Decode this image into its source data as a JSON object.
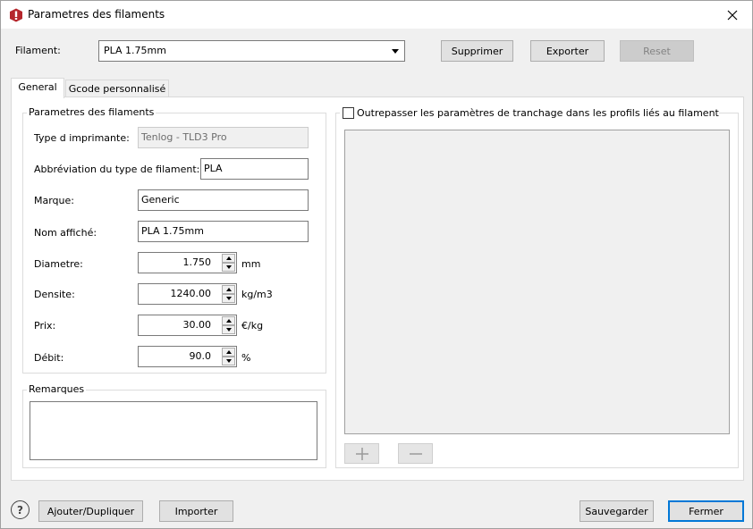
{
  "window": {
    "title": "Parametres des filaments"
  },
  "filament_row": {
    "label": "Filament:",
    "selected": "PLA 1.75mm"
  },
  "top_buttons": {
    "delete": "Supprimer",
    "export": "Exporter",
    "reset": "Reset"
  },
  "tabs": [
    {
      "label": "General"
    },
    {
      "label": "Gcode personnalisé"
    }
  ],
  "params": {
    "group_title": "Parametres des filaments",
    "printer_type": {
      "label": "Type d imprimante:",
      "value": "Tenlog - TLD3 Pro"
    },
    "abbrev": {
      "label": "Abbréviation du type de filament:",
      "value": "PLA"
    },
    "brand": {
      "label": "Marque:",
      "value": "Generic"
    },
    "display_name": {
      "label": "Nom affiché:",
      "value": "PLA 1.75mm"
    },
    "diameter": {
      "label": "Diametre:",
      "value": "1.750",
      "unit": "mm"
    },
    "density": {
      "label": "Densite:",
      "value": "1240.00",
      "unit": "kg/m3"
    },
    "price": {
      "label": "Prix:",
      "value": "30.00",
      "unit": "€/kg"
    },
    "flow": {
      "label": "Débit:",
      "value": "90.0",
      "unit": "%"
    }
  },
  "remarks": {
    "group_title": "Remarques",
    "value": ""
  },
  "override": {
    "label": "Outrepasser les paramètres de tranchage dans les profils liés au filament",
    "checked": false
  },
  "bottom_buttons": {
    "add": "Ajouter/Dupliquer",
    "import": "Importer",
    "save": "Sauvegarder",
    "close": "Fermer"
  },
  "colors": {
    "accent": "#0078d7",
    "app_icon": "#b5272d"
  }
}
